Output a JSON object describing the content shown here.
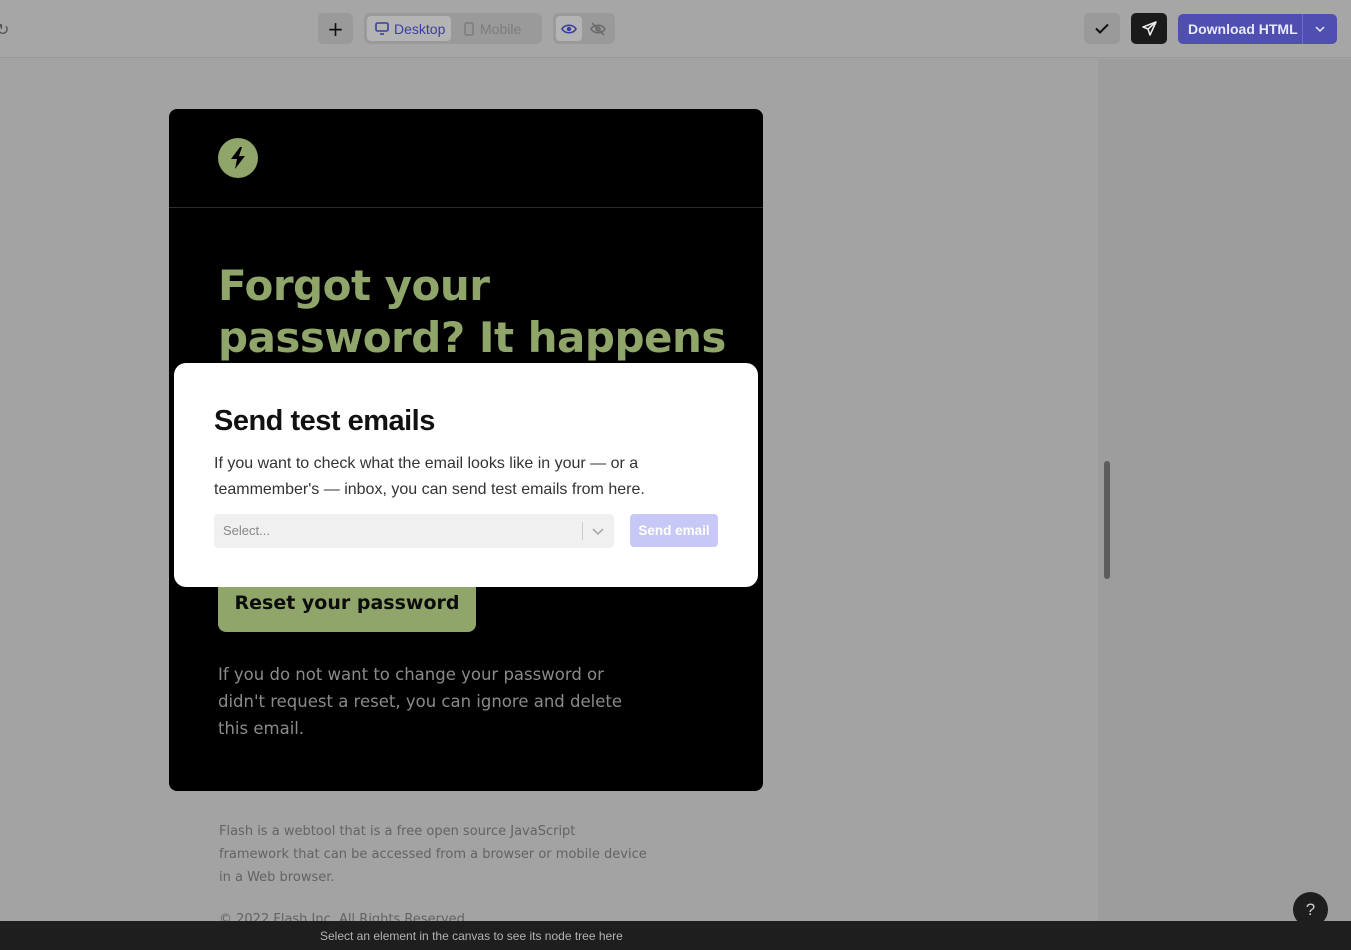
{
  "toolbar": {
    "add_symbol": "+",
    "view_modes": {
      "desktop": "Desktop",
      "mobile": "Mobile",
      "active": "desktop"
    },
    "download_label": "Download HTML",
    "accent_color": "#4f4fb2"
  },
  "email": {
    "headline": "Forgot your password? It happens to the best",
    "reset_button": "Reset your password",
    "ignore_text": "If you do not want to change your password or didn't request a reset, you can ignore and delete this email.",
    "footer_text": "Flash is a webtool that is a free open source JavaScript framework that can be accessed from a browser or mobile device in a Web browser.",
    "copyright": "© 2022 Flash Inc. All Rights Reserved",
    "brand_color": "#8fa56a"
  },
  "modal": {
    "title": "Send test emails",
    "description": "If you want to check what the email looks like in your — or a teammember's — inbox, you can send test emails from here.",
    "select_placeholder": "Select...",
    "send_button": "Send email"
  },
  "status_bar": {
    "hint": "Select an element in the canvas to see its node tree here"
  },
  "help_label": "?"
}
